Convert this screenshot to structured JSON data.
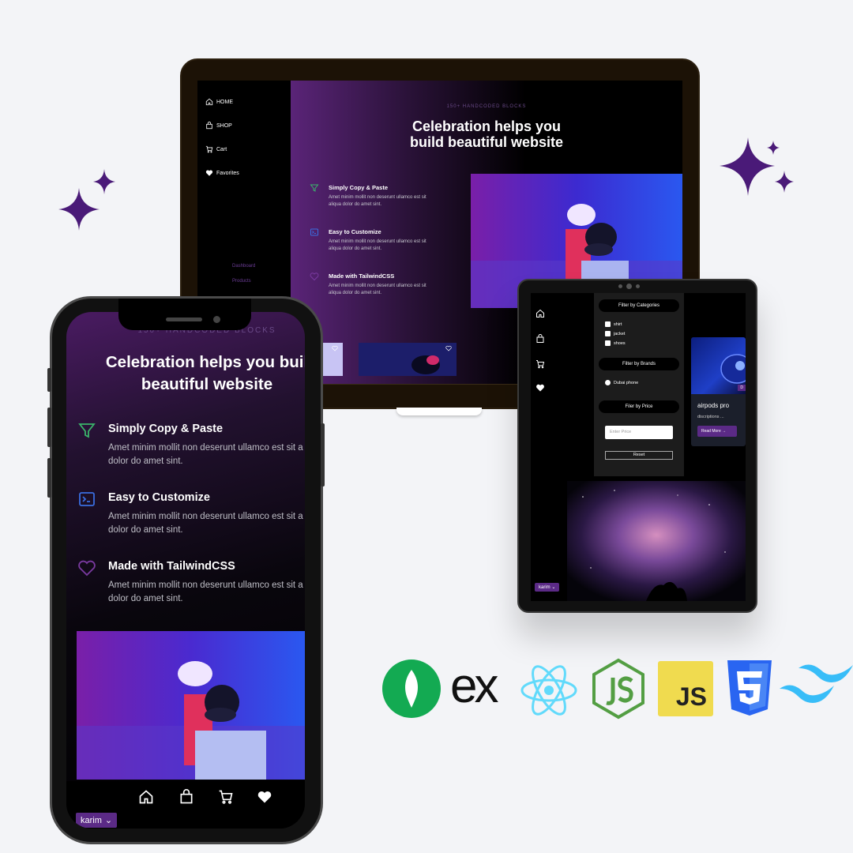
{
  "laptop": {
    "nav": [
      {
        "label": "HOME",
        "icon": "home-icon"
      },
      {
        "label": "SHOP",
        "icon": "bag-icon"
      },
      {
        "label": "Cart",
        "icon": "cart-icon"
      },
      {
        "label": "Favorites",
        "icon": "heart-icon"
      }
    ],
    "sub_links": [
      "Dashboard",
      "Products"
    ],
    "eyebrow": "150+ HANDCODED BLOCKS",
    "title_line1": "Celebration helps you",
    "title_line2": "build beautiful website",
    "features": [
      {
        "title": "Simply Copy & Paste",
        "desc": "Amet minim mollit non deserunt ullamco est sit aliqua dolor do amet sint.",
        "icon": "filter-icon"
      },
      {
        "title": "Easy to Customize",
        "desc": "Amet minim mollit non deserunt ullamco est sit aliqua dolor do amet sint.",
        "icon": "terminal-icon"
      },
      {
        "title": "Made with TailwindCSS",
        "desc": "Amet minim mollit non deserunt ullamco est sit aliqua dolor do amet sint.",
        "icon": "heart-outline-icon"
      }
    ]
  },
  "tablet": {
    "filter_categories": "Filter by Categories",
    "categories": [
      "shirt",
      "jacket",
      "shoes"
    ],
    "filter_brands": "Filter by Brands",
    "brands": [
      "Dubai phone"
    ],
    "filter_price": "Filer by Price",
    "price_placeholder": "Enter Price",
    "reset": "Reset",
    "card": {
      "title": "airpods pro",
      "desc": "discriptions ...",
      "button": "Read More",
      "badge": "D"
    },
    "user": "karim"
  },
  "phone": {
    "eyebrow": "150+ HANDCODED BLOCKS",
    "title_line1": "Celebration helps you buil",
    "title_line2": "beautiful website",
    "features": [
      {
        "title": "Simply Copy & Paste",
        "desc1": "Amet minim mollit non deserunt ullamco est sit a",
        "desc2": "dolor do amet sint."
      },
      {
        "title": "Easy to Customize",
        "desc1": "Amet minim mollit non deserunt ullamco est sit a",
        "desc2": "dolor do amet sint."
      },
      {
        "title": "Made with TailwindCSS",
        "desc1": "Amet minim mollit non deserunt ullamco est sit a",
        "desc2": "dolor do amet sint."
      }
    ],
    "tabs": [
      "home-icon",
      "bag-icon",
      "cart-icon",
      "heart-icon"
    ],
    "user": "karim"
  },
  "logos": {
    "express_text": "ex",
    "js_text": "JS",
    "items": [
      "mongodb-logo",
      "express-logo",
      "react-logo",
      "nodejs-logo",
      "javascript-logo",
      "css3-logo",
      "tailwind-logo"
    ]
  },
  "colors": {
    "accent_purple": "#5b2a86",
    "sparkle": "#4a1a78",
    "mongodb": "#13aa52",
    "react": "#61dafb",
    "node": "#539e43",
    "js": "#f0db4f",
    "css3": "#2965f1",
    "tailwind": "#38bdf8"
  }
}
